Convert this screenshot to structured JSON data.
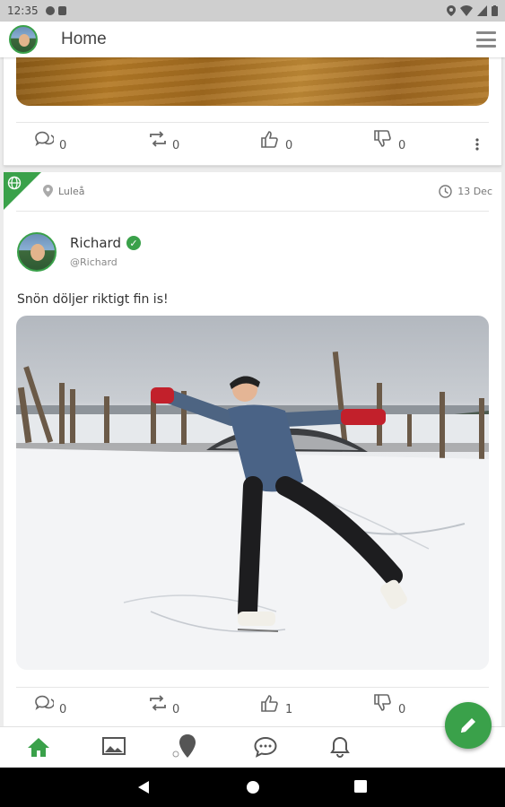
{
  "status_bar": {
    "time": "12:35"
  },
  "app_bar": {
    "title": "Home"
  },
  "post1": {
    "actions": {
      "comments": "0",
      "reposts": "0",
      "likes": "0",
      "dislikes": "0"
    }
  },
  "post2": {
    "location": "Luleå",
    "date": "13 Dec",
    "author": {
      "name": "Richard",
      "handle": "@Richard"
    },
    "text": "Snön döljer riktigt fin is!",
    "actions": {
      "comments": "0",
      "reposts": "0",
      "likes": "1",
      "dislikes": "0"
    }
  },
  "bottom_nav": {
    "items": [
      "home-icon",
      "gallery-icon",
      "map-pin-icon",
      "chat-icon",
      "bell-icon"
    ]
  },
  "icons": {
    "fab": "pencil-icon",
    "menu": "hamburger-menu-icon"
  },
  "colors": {
    "accent": "#3aa14a"
  }
}
